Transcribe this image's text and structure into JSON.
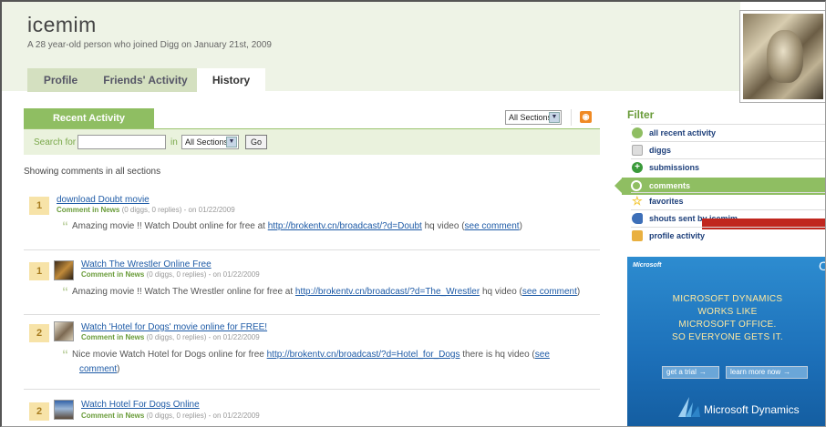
{
  "profile": {
    "username": "icemim",
    "tagline": "A 28 year-old person who joined Digg on January 21st, 2009",
    "tabs": [
      {
        "label": "Profile"
      },
      {
        "label": "Friends' Activity"
      },
      {
        "label": "History"
      }
    ],
    "active_tab": "History"
  },
  "activity": {
    "tab_label": "Recent Activity",
    "section_select": "All Sections",
    "search_label": "Search for",
    "search_value": "",
    "in_label": "in",
    "in_select": "All Sections",
    "go_label": "Go",
    "showing_text": "Showing comments in all sections",
    "entries": [
      {
        "diggs": "1",
        "title": "download Doubt movie",
        "meta_type": "Comment in News",
        "meta_rest": "(0 diggs, 0 replies) - on 01/22/2009",
        "text_pre": "Amazing movie !! Watch Doubt online for free at ",
        "link": "http://brokentv.cn/broadcast/?d=Doubt",
        "text_post": " hq video (",
        "see": "see comment",
        "close": ")"
      },
      {
        "diggs": "1",
        "title": "Watch The Wrestler Online Free",
        "meta_type": "Comment in News",
        "meta_rest": "(0 diggs, 0 replies) - on 01/22/2009",
        "text_pre": "Amazing movie !! Watch The Wrestler online for free at ",
        "link": "http://brokentv.cn/broadcast/?d=The_Wrestler",
        "text_post": " hq video (",
        "see": "see comment",
        "close": ")"
      },
      {
        "diggs": "2",
        "title": "Watch 'Hotel for Dogs' movie online for FREE!",
        "meta_type": "Comment in News",
        "meta_rest": "(0 diggs, 0 replies) - on 01/22/2009",
        "text_pre": "Nice movie Watch Hotel for Dogs online for free ",
        "link": "http://brokentv.cn/broadcast/?d=Hotel_for_Dogs",
        "text_post": " there is hq video (",
        "see": "see",
        "see2": "comment",
        "close": ")"
      },
      {
        "diggs": "2",
        "title": "Watch Hotel For Dogs Online",
        "meta_type": "Comment in News",
        "meta_rest": "(0 diggs, 0 replies) - on 01/22/2009"
      }
    ]
  },
  "filter": {
    "title": "Filter",
    "items": [
      {
        "label": "all recent activity",
        "icon": "asterisk-icon",
        "color": "#8fbe62"
      },
      {
        "label": "diggs",
        "icon": "digg-icon",
        "color": "#bbbbbb"
      },
      {
        "label": "submissions",
        "icon": "plus-icon",
        "color": "#3a9a3a"
      },
      {
        "label": "comments",
        "icon": "speech-bubble-icon",
        "color": "#ffffff"
      },
      {
        "label": "favorites",
        "icon": "star-icon",
        "color": "#f2c531"
      },
      {
        "label": "shouts sent by icemim",
        "icon": "megaphone-icon",
        "color": "#3d6fb8"
      },
      {
        "label": "profile activity",
        "icon": "profile-icon",
        "color": "#e9b040"
      }
    ],
    "active": "comments"
  },
  "ad": {
    "brand": "Microsoft",
    "lines": [
      "MICROSOFT DYNAMICS",
      "WORKS LIKE",
      "MICROSOFT OFFICE.",
      "SO EVERYONE GETS IT."
    ],
    "btn1": "get a trial",
    "btn2": "learn more now",
    "logo_text": "Microsoft Dynamics"
  },
  "colors": {
    "accent": "#8fbe62",
    "link": "#1d5aa6",
    "badge": "#f7e3a8",
    "ad_bg": "#1c6fb8"
  }
}
